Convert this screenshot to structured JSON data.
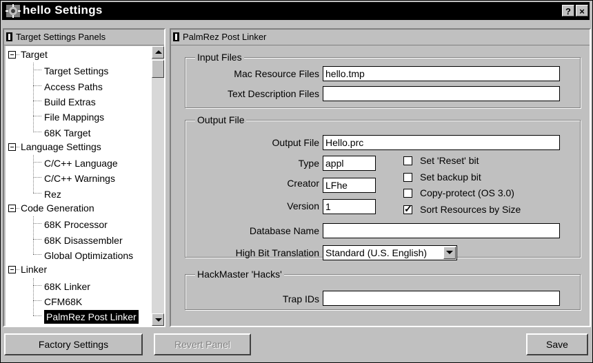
{
  "window": {
    "title": "hello Settings",
    "help_label": "?",
    "close_label": "×"
  },
  "tree": {
    "header": "Target Settings Panels",
    "items": [
      {
        "label": "Target",
        "level": 0
      },
      {
        "label": "Target Settings",
        "level": 1
      },
      {
        "label": "Access Paths",
        "level": 1
      },
      {
        "label": "Build Extras",
        "level": 1
      },
      {
        "label": "File Mappings",
        "level": 1
      },
      {
        "label": "68K Target",
        "level": 1
      },
      {
        "label": "Language Settings",
        "level": 0
      },
      {
        "label": "C/C++ Language",
        "level": 1
      },
      {
        "label": "C/C++ Warnings",
        "level": 1
      },
      {
        "label": "Rez",
        "level": 1
      },
      {
        "label": "Code Generation",
        "level": 0
      },
      {
        "label": "68K Processor",
        "level": 1
      },
      {
        "label": "68K Disassembler",
        "level": 1
      },
      {
        "label": "Global Optimizations",
        "level": 1
      },
      {
        "label": "Linker",
        "level": 0
      },
      {
        "label": "68K Linker",
        "level": 1
      },
      {
        "label": "CFM68K",
        "level": 1
      },
      {
        "label": "PalmRez Post Linker",
        "level": 1,
        "selected": true
      }
    ]
  },
  "panel": {
    "header": "PalmRez Post Linker",
    "input_files": {
      "title": "Input Files",
      "mac_resource_label": "Mac Resource Files",
      "mac_resource_value": "hello.tmp",
      "text_desc_label": "Text Description Files",
      "text_desc_value": ""
    },
    "output_file": {
      "title": "Output File",
      "output_label": "Output File",
      "output_value": "Hello.prc",
      "type_label": "Type",
      "type_value": "appl",
      "creator_label": "Creator",
      "creator_value": "LFhe",
      "version_label": "Version",
      "version_value": "1",
      "dbname_label": "Database Name",
      "dbname_value": "",
      "hibit_label": "High Bit Translation",
      "hibit_value": "Standard (U.S. English)",
      "checks": [
        {
          "label": "Set 'Reset' bit",
          "checked": false
        },
        {
          "label": "Set backup bit",
          "checked": false
        },
        {
          "label": "Copy-protect (OS 3.0)",
          "checked": false
        },
        {
          "label": "Sort Resources by Size",
          "checked": true
        }
      ],
      "check_mark": "✓"
    },
    "hackmaster": {
      "title": "HackMaster 'Hacks'",
      "trap_label": "Trap IDs",
      "trap_value": ""
    }
  },
  "buttons": {
    "factory": "Factory Settings",
    "revert": "Revert Panel",
    "save": "Save"
  }
}
